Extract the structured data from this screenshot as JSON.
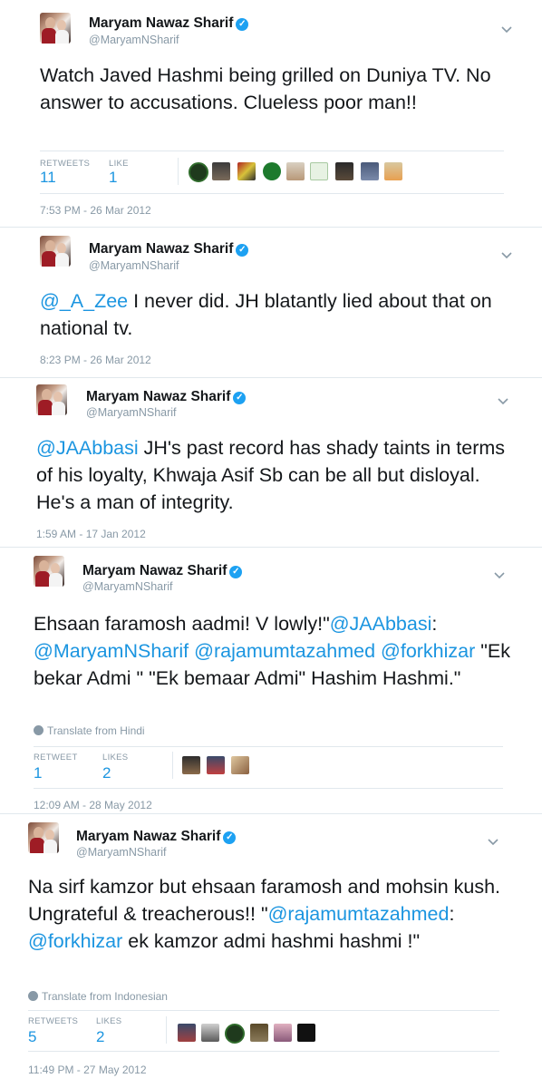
{
  "tweets": [
    {
      "name": "Maryam Nawaz Sharif",
      "handle": "@MaryamNSharif",
      "text": "Watch Javed Hashmi being grilled on Duniya TV. No answer to accusations. Clueless poor man!!",
      "stats": [
        {
          "label": "RETWEETS",
          "value": "11"
        },
        {
          "label": "LIKE",
          "value": "1"
        }
      ],
      "timestamp": "7:53 PM - 26 Mar 2012"
    },
    {
      "name": "Maryam Nawaz Sharif",
      "handle": "@MaryamNSharif",
      "mention": "@_A_Zee",
      "text": " I never did. JH blatantly lied about that on national tv.",
      "timestamp": "8:23 PM - 26 Mar 2012"
    },
    {
      "name": "Maryam Nawaz Sharif",
      "handle": "@MaryamNSharif",
      "mention": "@JAAbbasi",
      "text": " JH's past record has shady taints in terms of his loyalty, Khwaja Asif Sb can be all but disloyal. He's a man of integrity.",
      "timestamp": "1:59 AM - 17 Jan 2012"
    },
    {
      "name": "Maryam Nawaz Sharif",
      "handle": "@MaryamNSharif",
      "text_parts": [
        "Ehsaan faramosh aadmi! V lowly!\"",
        "@JAAbbasi",
        ": ",
        "@MaryamNSharif",
        " ",
        "@rajamumtazahmed",
        " ",
        "@forkhizar",
        " \"Ek bekar Admi \" \"Ek bemaar Admi\" Hashim Hashmi.\""
      ],
      "translate": "Translate from Hindi",
      "stats": [
        {
          "label": "RETWEET",
          "value": "1"
        },
        {
          "label": "LIKES",
          "value": "2"
        }
      ],
      "timestamp": "12:09 AM - 28 May 2012"
    },
    {
      "name": "Maryam Nawaz Sharif",
      "handle": "@MaryamNSharif",
      "text_parts": [
        "Na sirf kamzor but ehsaan faramosh and mohsin kush. Ungrateful & treacherous!! \"",
        "@rajamumtazahmed",
        ": ",
        "@forkhizar",
        " ek kamzor admi hashmi hashmi !\""
      ],
      "translate": "Translate from Indonesian",
      "stats": [
        {
          "label": "RETWEETS",
          "value": "5"
        },
        {
          "label": "LIKES",
          "value": "2"
        }
      ],
      "timestamp": "11:49 PM - 27 May 2012"
    }
  ],
  "colors": {
    "link": "#1b95e0",
    "verified": "#1da1f2",
    "muted": "#8899a6",
    "divider": "#e1e8ed"
  }
}
